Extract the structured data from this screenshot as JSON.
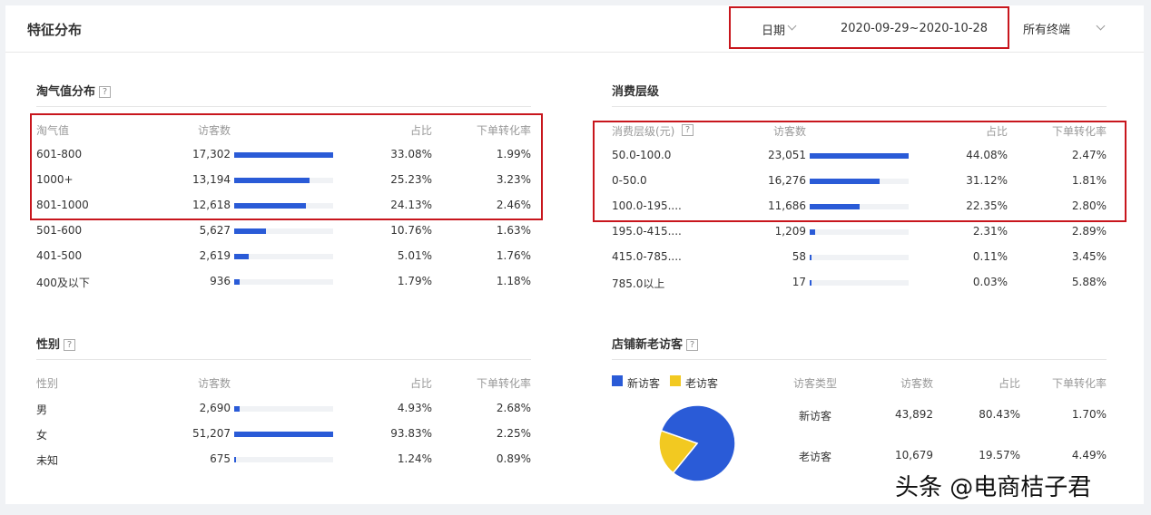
{
  "page": {
    "title": "特征分布"
  },
  "filters": {
    "date_label": "日期",
    "date_range": "2020-09-29~2020-10-28",
    "terminal": "所有终端"
  },
  "taoqi": {
    "title": "淘气值分布",
    "headers": [
      "淘气值",
      "访客数",
      "占比",
      "下单转化率"
    ],
    "rows": [
      {
        "label": "601-800",
        "visitors": "17,302",
        "share": "33.08%",
        "conv": "1.99%",
        "bar": 1.0
      },
      {
        "label": "1000+",
        "visitors": "13,194",
        "share": "25.23%",
        "conv": "3.23%",
        "bar": 0.763
      },
      {
        "label": "801-1000",
        "visitors": "12,618",
        "share": "24.13%",
        "conv": "2.46%",
        "bar": 0.729
      },
      {
        "label": "501-600",
        "visitors": "5,627",
        "share": "10.76%",
        "conv": "1.63%",
        "bar": 0.325
      },
      {
        "label": "401-500",
        "visitors": "2,619",
        "share": "5.01%",
        "conv": "1.76%",
        "bar": 0.151
      },
      {
        "label": "400及以下",
        "visitors": "936",
        "share": "1.79%",
        "conv": "1.18%",
        "bar": 0.054
      }
    ]
  },
  "consume": {
    "title": "消费层级",
    "headers": [
      "消费层级(元)",
      "访客数",
      "占比",
      "下单转化率"
    ],
    "rows": [
      {
        "label": "50.0-100.0",
        "visitors": "23,051",
        "share": "44.08%",
        "conv": "2.47%",
        "bar": 1.0
      },
      {
        "label": "0-50.0",
        "visitors": "16,276",
        "share": "31.12%",
        "conv": "1.81%",
        "bar": 0.706
      },
      {
        "label": "100.0-195....",
        "visitors": "11,686",
        "share": "22.35%",
        "conv": "2.80%",
        "bar": 0.507
      },
      {
        "label": "195.0-415....",
        "visitors": "1,209",
        "share": "2.31%",
        "conv": "2.89%",
        "bar": 0.052
      },
      {
        "label": "415.0-785....",
        "visitors": "58",
        "share": "0.11%",
        "conv": "3.45%",
        "bar": 0.0025
      },
      {
        "label": "785.0以上",
        "visitors": "17",
        "share": "0.03%",
        "conv": "5.88%",
        "bar": 0.0007
      }
    ]
  },
  "gender": {
    "title": "性别",
    "headers": [
      "性别",
      "访客数",
      "占比",
      "下单转化率"
    ],
    "rows": [
      {
        "label": "男",
        "visitors": "2,690",
        "share": "4.93%",
        "conv": "2.68%",
        "bar": 0.053
      },
      {
        "label": "女",
        "visitors": "51,207",
        "share": "93.83%",
        "conv": "2.25%",
        "bar": 1.0
      },
      {
        "label": "未知",
        "visitors": "675",
        "share": "1.24%",
        "conv": "0.89%",
        "bar": 0.013
      }
    ]
  },
  "newold": {
    "title": "店铺新老访客",
    "legend": [
      {
        "name": "新访客",
        "color": "#2a5bd7"
      },
      {
        "name": "老访客",
        "color": "#f2c921"
      }
    ],
    "headers": [
      "访客类型",
      "访客数",
      "占比",
      "下单转化率"
    ],
    "rows": [
      {
        "label": "新访客",
        "visitors": "43,892",
        "share": "80.43%",
        "conv": "1.70%"
      },
      {
        "label": "老访客",
        "visitors": "10,679",
        "share": "19.57%",
        "conv": "4.49%"
      }
    ],
    "pie": [
      {
        "name": "新访客",
        "value": 80.43,
        "color": "#2a5bd7"
      },
      {
        "name": "老访客",
        "value": 19.57,
        "color": "#f2c921"
      }
    ]
  },
  "icons": {
    "help": "help-icon",
    "chevron": "chevron-down-icon"
  },
  "watermark": "头条 @电商桔子君"
}
